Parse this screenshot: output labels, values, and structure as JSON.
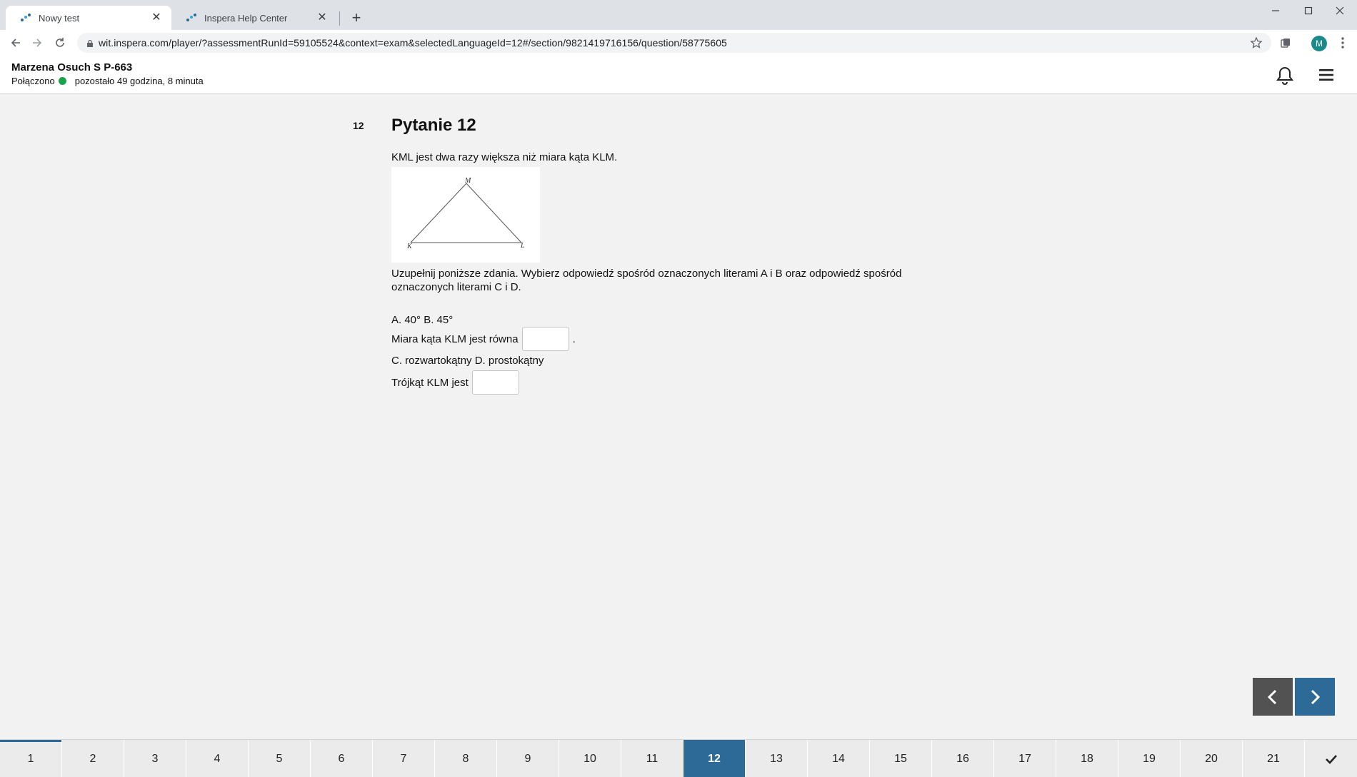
{
  "browser": {
    "tabs": [
      {
        "title": "Nowy test",
        "active": true
      },
      {
        "title": "Inspera Help Center",
        "active": false
      }
    ],
    "url": "wit.inspera.com/player/?assessmentRunId=59105524&context=exam&selectedLanguageId=12#/section/9821419716156/question/58775605",
    "profile_initial": "M"
  },
  "header": {
    "candidate": "Marzena Osuch S P-663",
    "connection_status": "Połączono",
    "time_remaining": "pozostało 49 godzina, 8 minuta"
  },
  "question": {
    "number": "12",
    "title": "Pytanie 12",
    "intro": "KML jest dwa razy większa niż miara kąta KLM.",
    "figure_labels": {
      "top": "M",
      "left": "K",
      "right": "L"
    },
    "instruction": "Uzupełnij poniższe zdania. Wybierz odpowiedź spośród oznaczonych literami A i B oraz odpowiedź spośród oznaczonych literami C i D.",
    "options_ab": "A. 40° B. 45°",
    "sentence_1": "Miara kąta KLM jest równa",
    "sentence_1_end": ".",
    "options_cd": "C. rozwartokątny D. prostokątny",
    "sentence_2": "Trójkąt KLM jest"
  },
  "navigation": {
    "items": [
      "1",
      "2",
      "3",
      "4",
      "5",
      "6",
      "7",
      "8",
      "9",
      "10",
      "11",
      "12",
      "13",
      "14",
      "15",
      "16",
      "17",
      "18",
      "19",
      "20",
      "21"
    ],
    "current": "12"
  },
  "colors": {
    "accent": "#2d6a98",
    "connected": "#1ba34a",
    "prev_button": "#525252"
  }
}
